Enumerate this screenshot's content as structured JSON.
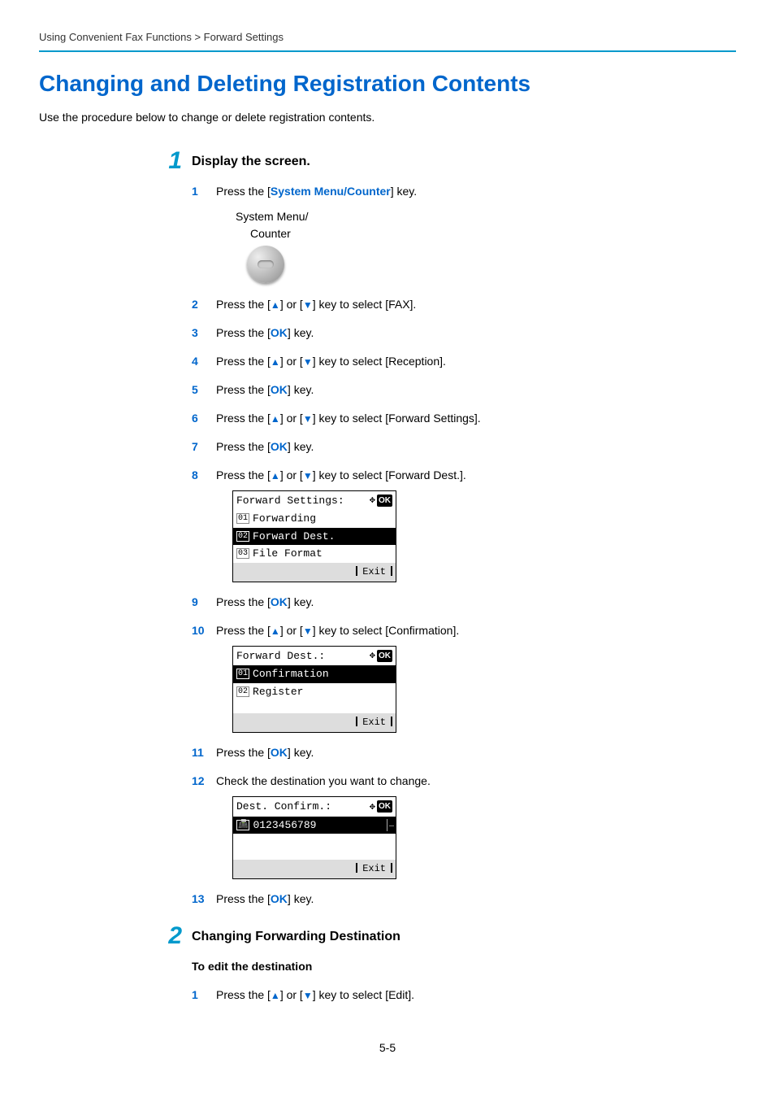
{
  "breadcrumb": "Using Convenient Fax Functions > Forward Settings",
  "title": "Changing and Deleting Registration Contents",
  "intro": "Use the procedure below to change or delete registration contents.",
  "page_number": "5-5",
  "section1": {
    "num": "1",
    "heading": "Display the screen.",
    "sys_btn_label1": "System Menu/",
    "sys_btn_label2": "Counter",
    "steps": {
      "s1": {
        "num": "1",
        "pre": "Press the [",
        "link": "System Menu/Counter",
        "post": "] key."
      },
      "s2": {
        "num": "2",
        "pre": "Press the [",
        "mid1": "] or [",
        "mid2": "] key to select [FAX]."
      },
      "s3": {
        "num": "3",
        "pre": "Press the [",
        "link": "OK",
        "post": "] key."
      },
      "s4": {
        "num": "4",
        "pre": "Press the [",
        "mid1": "] or [",
        "mid2": "] key to select [Reception]."
      },
      "s5": {
        "num": "5",
        "pre": "Press the [",
        "link": "OK",
        "post": "] key."
      },
      "s6": {
        "num": "6",
        "pre": "Press the [",
        "mid1": "] or [",
        "mid2": "] key to select [Forward Settings]."
      },
      "s7": {
        "num": "7",
        "pre": "Press the [",
        "link": "OK",
        "post": "] key."
      },
      "s8": {
        "num": "8",
        "pre": "Press the [",
        "mid1": "] or [",
        "mid2": "] key to select [Forward Dest.]."
      },
      "s9": {
        "num": "9",
        "pre": "Press the [",
        "link": "OK",
        "post": "] key."
      },
      "s10": {
        "num": "10",
        "pre": "Press the [",
        "mid1": "] or [",
        "mid2": "] key to select [Confirmation]."
      },
      "s11": {
        "num": "11",
        "pre": "Press the [",
        "link": "OK",
        "post": "] key."
      },
      "s12": {
        "num": "12",
        "text": "Check the destination you want to change."
      },
      "s13": {
        "num": "13",
        "pre": "Press the [",
        "link": "OK",
        "post": "] key."
      }
    }
  },
  "lcd1": {
    "title": "Forward Settings:",
    "rows": [
      {
        "num": "01",
        "label": "Forwarding",
        "selected": false
      },
      {
        "num": "02",
        "label": "Forward Dest.",
        "selected": true
      },
      {
        "num": "03",
        "label": "File Format",
        "selected": false
      }
    ],
    "exit": "Exit"
  },
  "lcd2": {
    "title": "Forward Dest.:",
    "rows": [
      {
        "num": "01",
        "label": "Confirmation",
        "selected": true
      },
      {
        "num": "02",
        "label": "Register",
        "selected": false
      }
    ],
    "exit": "Exit"
  },
  "lcd3": {
    "title": "Dest. Confirm.:",
    "dest": "0123456789",
    "exit": "Exit"
  },
  "section2": {
    "num": "2",
    "heading": "Changing Forwarding Destination",
    "subheading": "To edit the destination",
    "steps": {
      "s1": {
        "num": "1",
        "pre": "Press the [",
        "mid1": "] or [",
        "mid2": "] key to select [Edit]."
      }
    }
  },
  "glyphs": {
    "up": "▲",
    "down": "▼",
    "nav": "✥",
    "ok": "OK",
    "fax": "📠"
  }
}
